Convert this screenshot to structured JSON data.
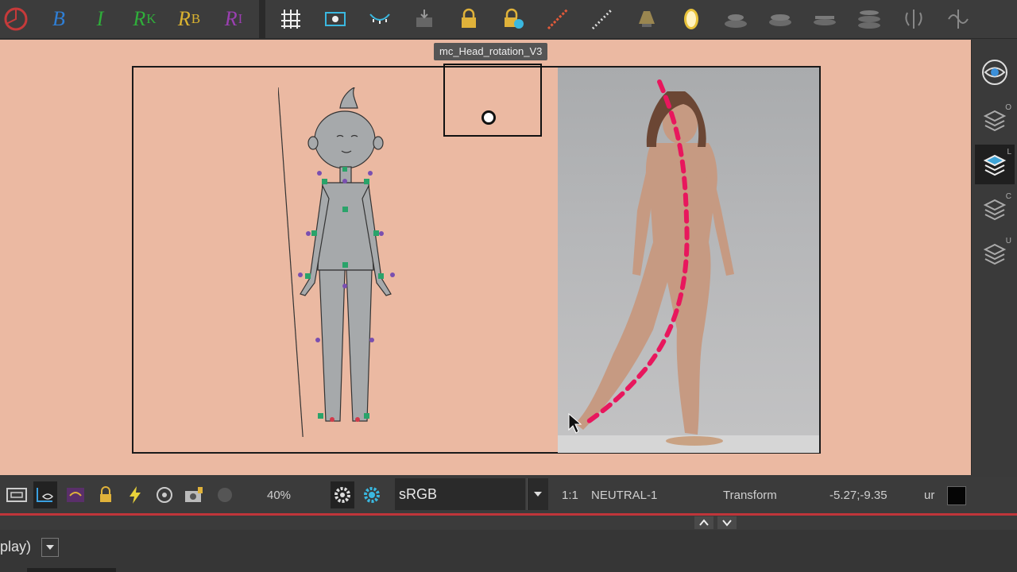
{
  "toolbar": {
    "layer_buttons": [
      {
        "letter": "B",
        "sub": "",
        "color": "#2f7fd6",
        "icon": "bitmap-layer-icon"
      },
      {
        "letter": "I",
        "sub": "",
        "color": "#2fae3a",
        "icon": "ink-layer-icon"
      },
      {
        "letter": "R",
        "sub": "K",
        "color": "#2fae3a",
        "icon": "reference-k-icon"
      },
      {
        "letter": "R",
        "sub": "B",
        "color": "#d9b230",
        "icon": "reference-b-icon"
      },
      {
        "letter": "R",
        "sub": "I",
        "color": "#9a3fb0",
        "icon": "reference-i-icon"
      }
    ],
    "tools": [
      "grid-icon",
      "camera-frame-icon",
      "onion-skin-icon",
      "import-icon",
      "lock-icon",
      "lock-add-icon",
      "bone-chain-icon",
      "ruler-icon",
      "light-icon",
      "mirror-icon",
      "stack-1-icon",
      "stack-2-icon",
      "stack-3-icon",
      "stack-4-icon",
      "symmetry-icon",
      "curve-icon"
    ]
  },
  "canvas": {
    "tooltip": "mc_Head_rotation_V3",
    "background": "#ebb9a2",
    "accent_dash": "#e8175d"
  },
  "right_panel": [
    {
      "icon": "eye-icon",
      "key": ""
    },
    {
      "icon": "layers-o-icon",
      "key": "O"
    },
    {
      "icon": "layers-l-icon",
      "key": "L"
    },
    {
      "icon": "layers-c-icon",
      "key": "C"
    },
    {
      "icon": "layers-u-icon",
      "key": "U"
    }
  ],
  "statusbar": {
    "zoom": "40%",
    "colorspace": "sRGB",
    "ratio": "1:1",
    "palette": "NEUTRAL-1",
    "mode": "Transform",
    "coords": "-5.27;-9.35",
    "unit": "ur"
  },
  "bottombar": {
    "display_label": "play)"
  }
}
